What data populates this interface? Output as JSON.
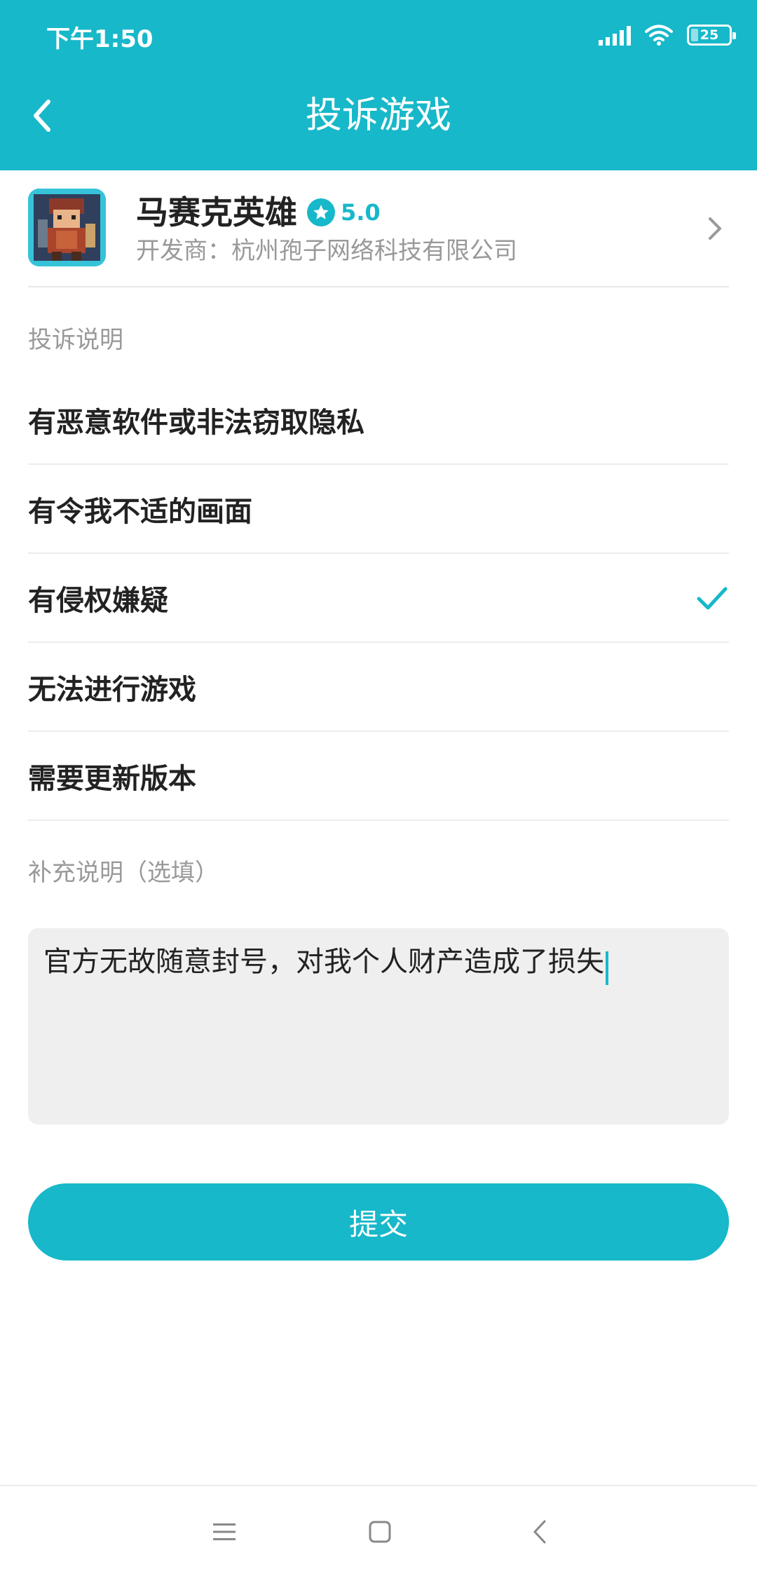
{
  "status_bar": {
    "time": "下午1:50",
    "battery": "25",
    "battery_level": 0.25
  },
  "header": {
    "title": "投诉游戏",
    "back_icon": "chevron-left-icon"
  },
  "game": {
    "name": "马赛克英雄",
    "rating": "5.0",
    "developer": "开发商：杭州孢子网络科技有限公司"
  },
  "complaint": {
    "section_label": "投诉说明",
    "reasons": [
      {
        "label": "有恶意软件或非法窃取隐私",
        "selected": false
      },
      {
        "label": "有令我不适的画面",
        "selected": false
      },
      {
        "label": "有侵权嫌疑",
        "selected": true
      },
      {
        "label": "无法进行游戏",
        "selected": false
      },
      {
        "label": "需要更新版本",
        "selected": false
      }
    ]
  },
  "supplement": {
    "section_label": "补充说明（选填）",
    "value": "官方无故随意封号，对我个人财产造成了损失"
  },
  "submit": {
    "label": "提交"
  },
  "colors": {
    "accent": "#17b8c9",
    "divider": "#ececec",
    "muted_text": "#999999",
    "input_bg": "#efefef"
  }
}
